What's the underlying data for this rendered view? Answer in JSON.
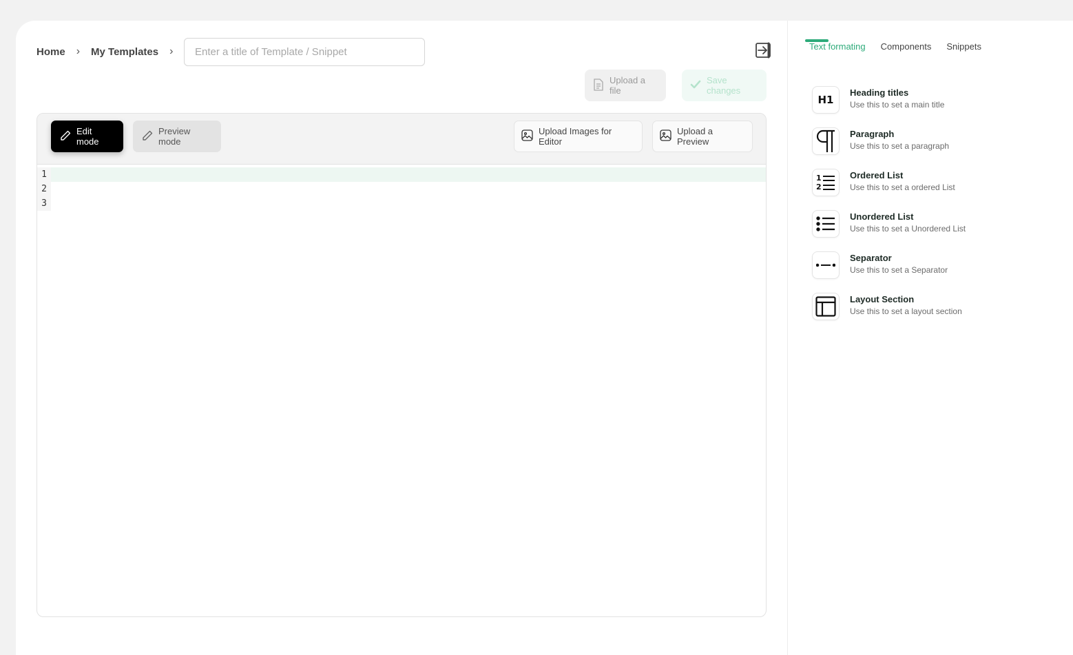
{
  "breadcrumb": {
    "items": [
      "Home",
      "My Templates"
    ],
    "separator": "›"
  },
  "title_input": {
    "value": "",
    "placeholder": "Enter a title of Template / Snippet"
  },
  "header_actions": {
    "exit_icon": "exit-icon",
    "upload_file_label": "Upload a file",
    "save_changes_label": "Save changes"
  },
  "editor": {
    "toolbar": {
      "edit_mode_label": "Edit mode",
      "preview_mode_label": "Preview mode",
      "upload_images_label": "Upload Images for Editor",
      "upload_preview_label": "Upload a Preview"
    },
    "line_numbers": [
      "1",
      "2",
      "3"
    ],
    "lines": [
      "",
      "",
      ""
    ]
  },
  "sidebar": {
    "tabs": [
      {
        "label": "Text formating",
        "active": true
      },
      {
        "label": "Components",
        "active": false
      },
      {
        "label": "Snippets",
        "active": false
      }
    ],
    "items": [
      {
        "icon": "heading-icon",
        "glyph": "H1",
        "title": "Heading titles",
        "desc": "Use this to set a main title"
      },
      {
        "icon": "paragraph-icon",
        "title": "Paragraph",
        "desc": "Use this to set a paragraph"
      },
      {
        "icon": "ordered-list-icon",
        "title": "Ordered List",
        "desc": "Use this to set a ordered List"
      },
      {
        "icon": "unordered-list-icon",
        "title": "Unordered List",
        "desc": "Use this to set a Unordered List"
      },
      {
        "icon": "separator-icon",
        "title": "Separator",
        "desc": "Use this to set a Separator"
      },
      {
        "icon": "layout-section-icon",
        "title": "Layout Section",
        "desc": "Use this to set a layout section"
      }
    ]
  },
  "colors": {
    "accent": "#2eab7a",
    "page_background": "#f2f2f2",
    "edit_mode_background": "#000000",
    "active_line": "#edf7f2"
  }
}
